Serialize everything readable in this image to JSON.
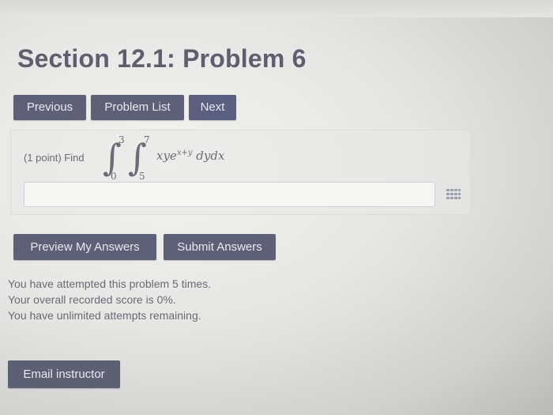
{
  "header": {
    "title": "Section 12.1: Problem 6"
  },
  "nav": {
    "previous_label": "Previous",
    "problem_list_label": "Problem List",
    "next_label": "Next"
  },
  "problem": {
    "prompt": "(1 point) Find",
    "outer_upper": "3",
    "outer_lower": "0",
    "inner_upper": "7",
    "inner_lower": "5",
    "integrand_base": "xye",
    "integrand_exponent": "x+y",
    "differentials": "dydx",
    "answer_value": "",
    "grid_icon": "equation-editor-icon"
  },
  "actions": {
    "preview_label": "Preview My Answers",
    "submit_label": "Submit Answers"
  },
  "status": {
    "attempts": "You have attempted this problem 5 times.",
    "score": "Your overall recorded score is 0%.",
    "remaining": "You have unlimited attempts remaining."
  },
  "footer": {
    "email_label": "Email instructor"
  },
  "colors": {
    "button_bg": "#5e6078",
    "title_text": "#5e5e6e"
  }
}
